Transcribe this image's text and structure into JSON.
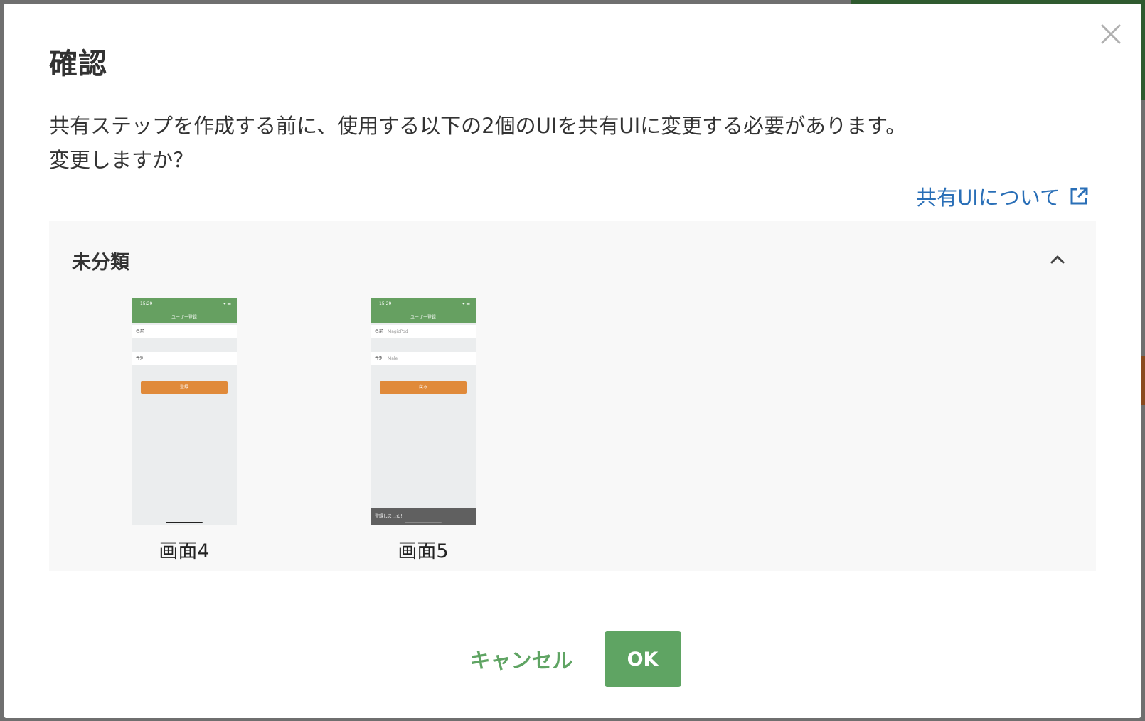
{
  "dialog": {
    "title": "確認",
    "message_line1": "共有ステップを作成する前に、使用する以下の2個のUIを共有UIに変更する必要があります。",
    "message_line2": "変更しますか？",
    "help_link": "共有UIについて",
    "cancel_label": "キャンセル",
    "ok_label": "OK"
  },
  "category": {
    "title": "未分類",
    "screens": [
      {
        "label": "画面4",
        "time": "15:29",
        "header_title": "ユーザー登録",
        "field1_label": "名前",
        "field1_value": "",
        "field2_label": "性別",
        "field2_value": "",
        "button_label": "登録",
        "toast": ""
      },
      {
        "label": "画面5",
        "time": "15:29",
        "header_title": "ユーザー登録",
        "field1_label": "名前",
        "field1_value": "MagicPod",
        "field2_label": "性別",
        "field2_value": "Male",
        "button_label": "戻る",
        "toast": "登録しました！"
      }
    ]
  },
  "colors": {
    "primary_green": "#5fa463",
    "link_blue": "#2a6fb7",
    "thumb_header": "#66a061",
    "thumb_button": "#e08a3a"
  },
  "icons": {
    "close": "close-icon",
    "external_link": "external-link-icon",
    "collapse": "chevron-up-icon"
  }
}
